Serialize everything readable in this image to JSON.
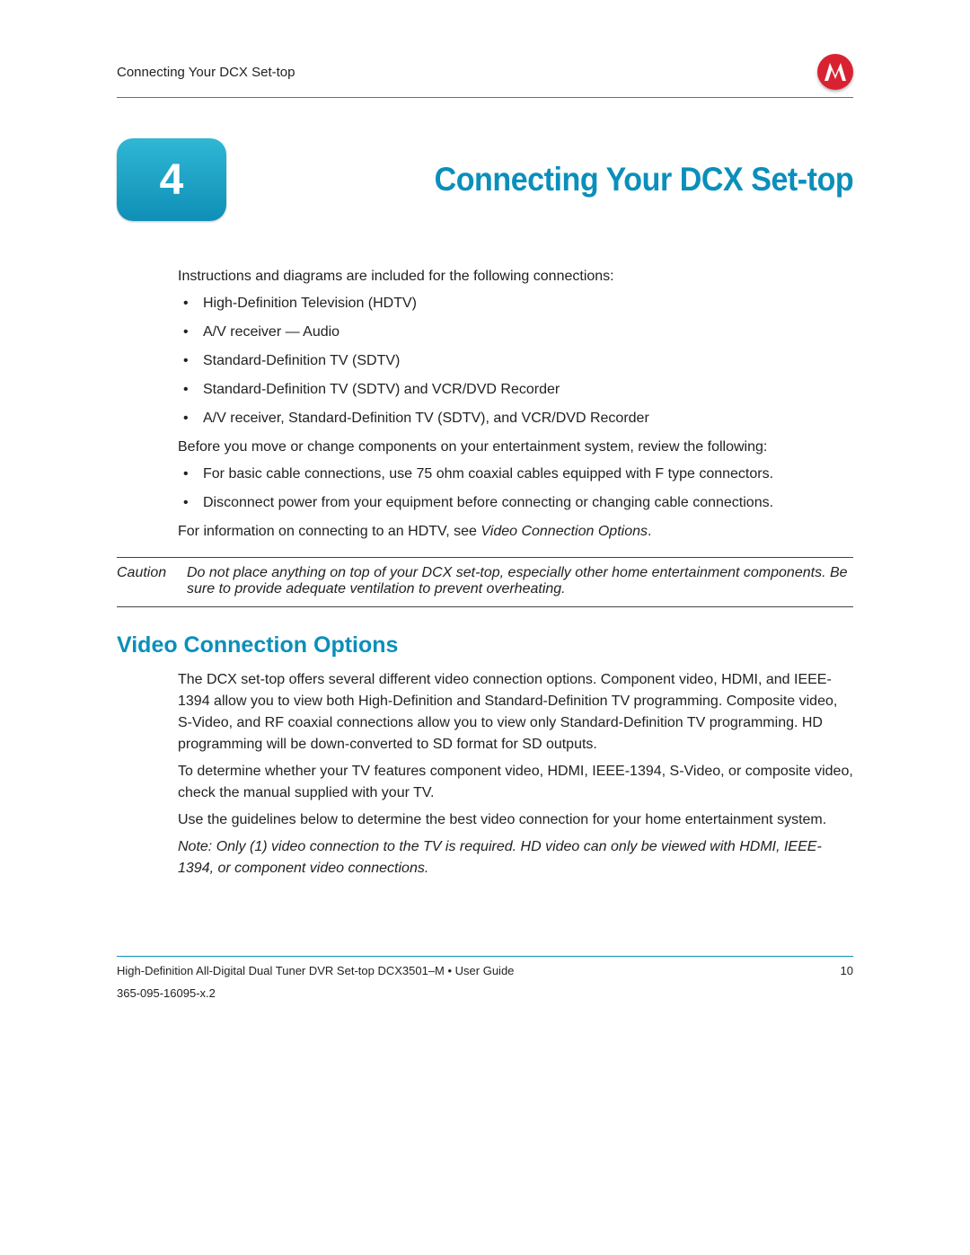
{
  "header": {
    "breadcrumb": "Connecting Your DCX Set-top"
  },
  "chapter": {
    "number": "4",
    "title": "Connecting Your DCX Set-top"
  },
  "intro": "Instructions and diagrams are included for the following connections:",
  "connections": [
    "High-Definition Television (HDTV)",
    "A/V receiver — Audio",
    "Standard-Definition TV (SDTV)",
    "Standard-Definition TV (SDTV) and VCR/DVD Recorder",
    "A/V receiver, Standard-Definition TV (SDTV), and VCR/DVD Recorder"
  ],
  "review_intro": "Before you move or change components on your entertainment system, review the following:",
  "review_items": [
    "For basic cable connections, use 75 ohm coaxial cables equipped with F type connectors.",
    "Disconnect power from your equipment before connecting or changing cable connections."
  ],
  "info_line_prefix": "For information on connecting to an HDTV, see ",
  "info_line_italic": "Video Connection Options",
  "info_line_suffix": ".",
  "caution": {
    "label": "Caution",
    "text": "Do not place anything on top of your DCX set-top, especially other home entertainment components. Be sure to provide adequate ventilation to prevent overheating."
  },
  "section": {
    "title": "Video Connection Options",
    "p1": "The DCX set-top offers several different video connection options. Component video, HDMI, and IEEE-1394 allow you to view both High-Definition and Standard-Definition TV programming. Composite video, S-Video, and RF coaxial connections allow you to view only Standard-Definition TV programming. HD programming will be down-converted to SD format for SD outputs.",
    "p2": "To determine whether your TV features component video, HDMI, IEEE-1394, S-Video, or composite video, check the manual supplied with your TV.",
    "p3": "Use the guidelines below to determine the best video connection for your home entertainment system.",
    "note": "Note: Only (1) video connection to the TV is required. HD video can only be viewed with HDMI, IEEE-1394, or component video connections."
  },
  "footer": {
    "doc": "High-Definition All-Digital Dual Tuner DVR Set-top DCX3501–M • User Guide",
    "partnum": "365-095-16095-x.2",
    "page": "10"
  }
}
